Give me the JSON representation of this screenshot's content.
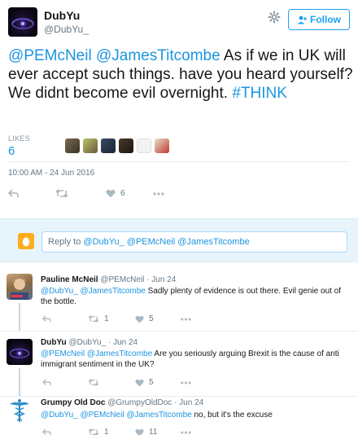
{
  "main_tweet": {
    "display_name": "DubYu",
    "handle": "@DubYu_",
    "follow_label": "Follow",
    "text_mention1": "@PEMcNeil",
    "text_mention2": "@JamesTitcombe",
    "text_body": "As if we in UK will ever accept such things. have you heard yourself? We didnt become evil overnight.",
    "text_hashtag": "#THINK",
    "likes_label": "LIKES",
    "likes_count": "6",
    "timestamp": "10:00 AM - 24 Jun 2016",
    "like_action_count": "6"
  },
  "reply_box": {
    "prefix": "Reply to",
    "mentions": "@DubYu_ @PEMcNeil @JamesTitcombe"
  },
  "replies": [
    {
      "name": "Pauline McNeil",
      "handle": "@PEMcNeil",
      "date": "· Jun 24",
      "mentions": "@DubYu_ @JamesTitcombe",
      "text": "Sadly plenty of evidence is out there. Evil genie out of the bottle.",
      "retweets": "1",
      "likes": "5"
    },
    {
      "name": "DubYu",
      "handle": "@DubYu_",
      "date": "· Jun 24",
      "mentions": "@PEMcNeil @JamesTitcombe",
      "text": "Are you seriously arguing Brexit is the cause of anti immigrant sentiment in the UK?",
      "retweets": "",
      "likes": "5"
    },
    {
      "name": "Grumpy Old Doc",
      "handle": "@GrumpyOldDoc",
      "date": "· Jun 24",
      "mentions": "@DubYu_ @PEMcNeil @JamesTitcombe",
      "text": "no, but it's the excuse",
      "retweets": "1",
      "likes": "11"
    }
  ],
  "icons": {
    "reply": "reply-icon",
    "retweet": "retweet-icon",
    "like": "heart-icon",
    "more": "more-icon",
    "settings": "gear-icon",
    "follow": "add-user-icon"
  },
  "colors": {
    "link": "#1b95e0",
    "follow": "#1da1f2",
    "reply_bg": "#e8f4fb",
    "muted": "#657786"
  }
}
